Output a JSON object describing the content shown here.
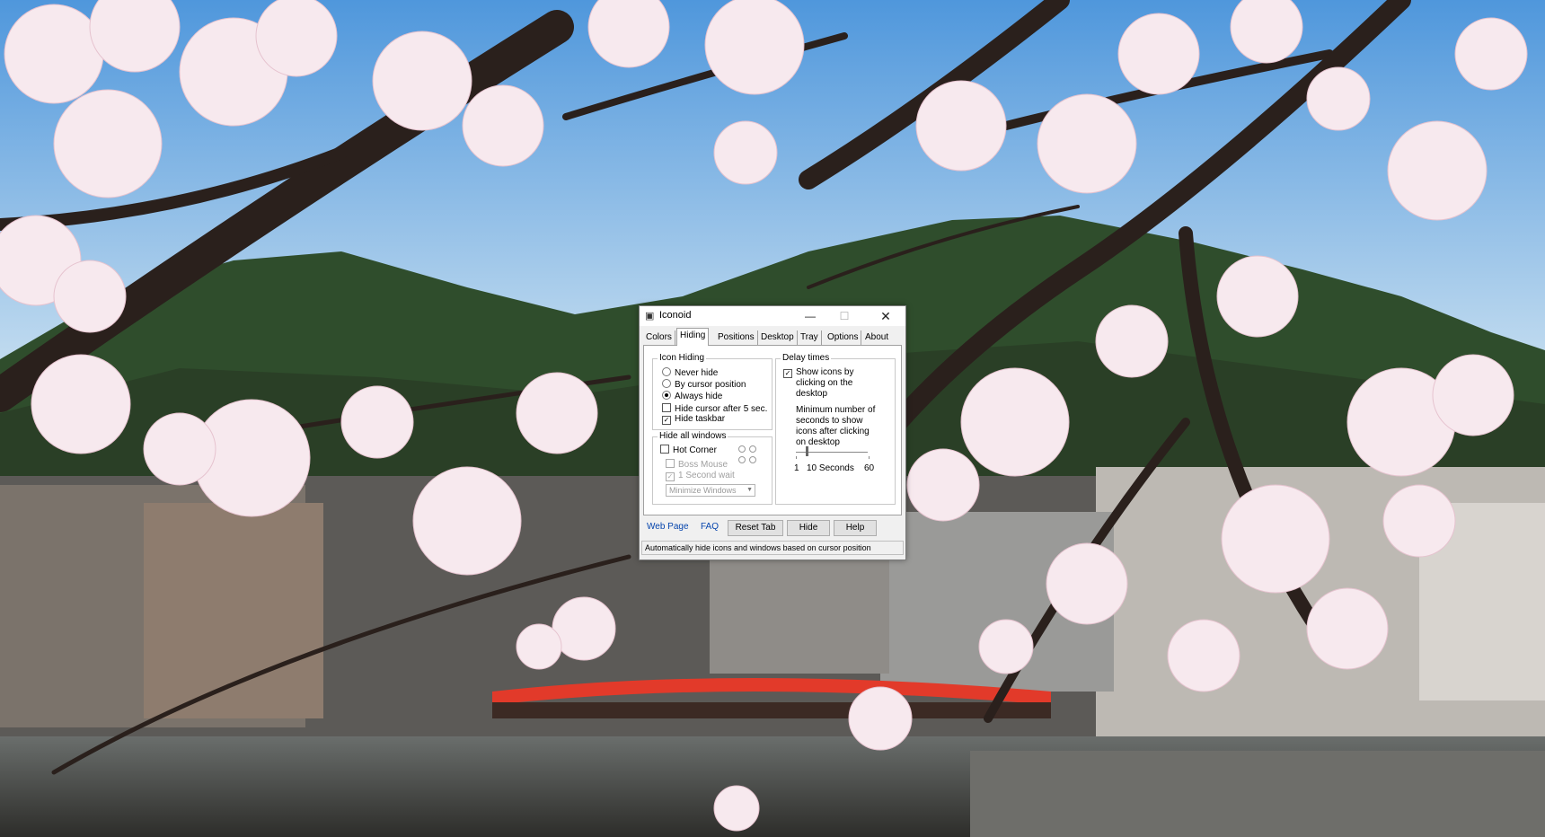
{
  "window": {
    "title": "Iconoid",
    "minimize_glyph": "—",
    "maximize_glyph": "☐",
    "close_glyph": "✕"
  },
  "tabs": [
    {
      "label": "Colors",
      "active": false
    },
    {
      "label": "Hiding",
      "active": true
    },
    {
      "label": "Positions",
      "active": false
    },
    {
      "label": "Desktop",
      "active": false
    },
    {
      "label": "Tray",
      "active": false
    },
    {
      "label": "Options",
      "active": false
    },
    {
      "label": "About",
      "active": false
    }
  ],
  "icon_hiding": {
    "legend": "Icon Hiding",
    "never_hide": "Never hide",
    "by_cursor": "By cursor position",
    "always_hide": "Always hide",
    "selected": "Always hide",
    "hide_cursor": "Hide cursor after 5 sec.",
    "hide_cursor_checked": false,
    "hide_taskbar": "Hide taskbar",
    "hide_taskbar_checked": true
  },
  "hide_all_windows": {
    "legend": "Hide all windows",
    "hot_corner": "Hot Corner",
    "hot_corner_checked": false,
    "boss_mouse": "Boss Mouse",
    "one_second_wait": "1 Second wait",
    "one_second_wait_checked": true,
    "action": "Minimize Windows"
  },
  "delay_times": {
    "legend": "Delay times",
    "show_icons_line1": "Show icons by",
    "show_icons_line2": "clicking on the",
    "show_icons_line3": "desktop",
    "show_icons_checked": true,
    "min_line1": "Minimum number of",
    "min_line2": "seconds to show",
    "min_line3": "icons after clicking",
    "min_line4": "on desktop",
    "slider_min": "1",
    "slider_value": "10 Seconds",
    "slider_max": "60",
    "slider_fraction": 0.15
  },
  "footer": {
    "web_page": "Web Page",
    "faq": "FAQ",
    "reset_tab": "Reset Tab",
    "hide": "Hide",
    "help": "Help"
  },
  "status": "Automatically hide icons and windows based on cursor position",
  "icons": {
    "app": "app-icon"
  }
}
